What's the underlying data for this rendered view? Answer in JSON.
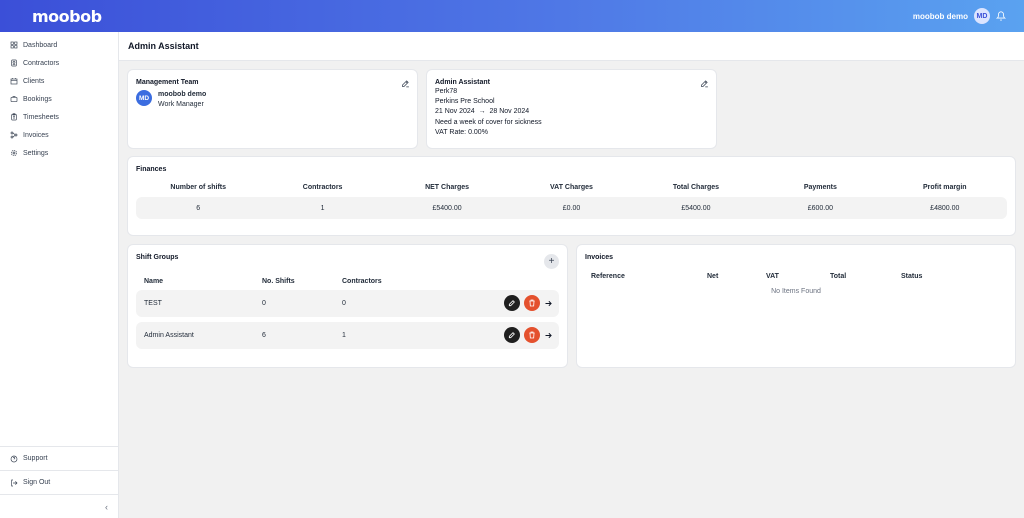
{
  "topbar": {
    "logo": "moobob",
    "user_name": "moobob demo",
    "user_initials": "MD"
  },
  "sidebar": {
    "items": [
      {
        "label": "Dashboard",
        "icon": "grid-icon"
      },
      {
        "label": "Contractors",
        "icon": "badge-icon"
      },
      {
        "label": "Clients",
        "icon": "building-icon"
      },
      {
        "label": "Bookings",
        "icon": "briefcase-icon"
      },
      {
        "label": "Timesheets",
        "icon": "clipboard-icon"
      },
      {
        "label": "Invoices",
        "icon": "flow-icon"
      },
      {
        "label": "Settings",
        "icon": "gear-icon"
      }
    ],
    "bottom": [
      {
        "label": "Support",
        "icon": "help-icon"
      },
      {
        "label": "Sign Out",
        "icon": "signout-icon"
      }
    ],
    "collapse_label": "‹"
  },
  "page": {
    "title": "Admin Assistant"
  },
  "management_team": {
    "title": "Management Team",
    "initials": "MD",
    "name": "moobob demo",
    "role": "Work Manager"
  },
  "assignment": {
    "title": "Admin Assistant",
    "code": "Perk78",
    "client": "Perkins Pre School",
    "start_date": "21 Nov 2024",
    "date_arrow": "→",
    "end_date": "28 Nov 2024",
    "description": "Need a week of cover for sickness",
    "vat_rate": "VAT Rate: 0.00%"
  },
  "finances": {
    "title": "Finances",
    "headers": [
      "Number of shifts",
      "Contractors",
      "NET Charges",
      "VAT Charges",
      "Total Charges",
      "Payments",
      "Profit margin"
    ],
    "values": [
      "6",
      "1",
      "£5400.00",
      "£0.00",
      "£5400.00",
      "£600.00",
      "£4800.00"
    ]
  },
  "shift_groups": {
    "title": "Shift Groups",
    "add_label": "+",
    "headers": [
      "Name",
      "No. Shifts",
      "Contractors"
    ],
    "rows": [
      {
        "name": "TEST",
        "shifts": "0",
        "contractors": "0"
      },
      {
        "name": "Admin Assistant",
        "shifts": "6",
        "contractors": "1"
      }
    ]
  },
  "invoices": {
    "title": "Invoices",
    "headers": [
      "Reference",
      "Net",
      "VAT",
      "Total",
      "Status"
    ],
    "empty_text": "No Items Found"
  },
  "colors": {
    "brand_start": "#3b4fd8",
    "brand_end": "#5aa2f0",
    "delete": "#e4512e",
    "edit": "#1f1f1f"
  }
}
